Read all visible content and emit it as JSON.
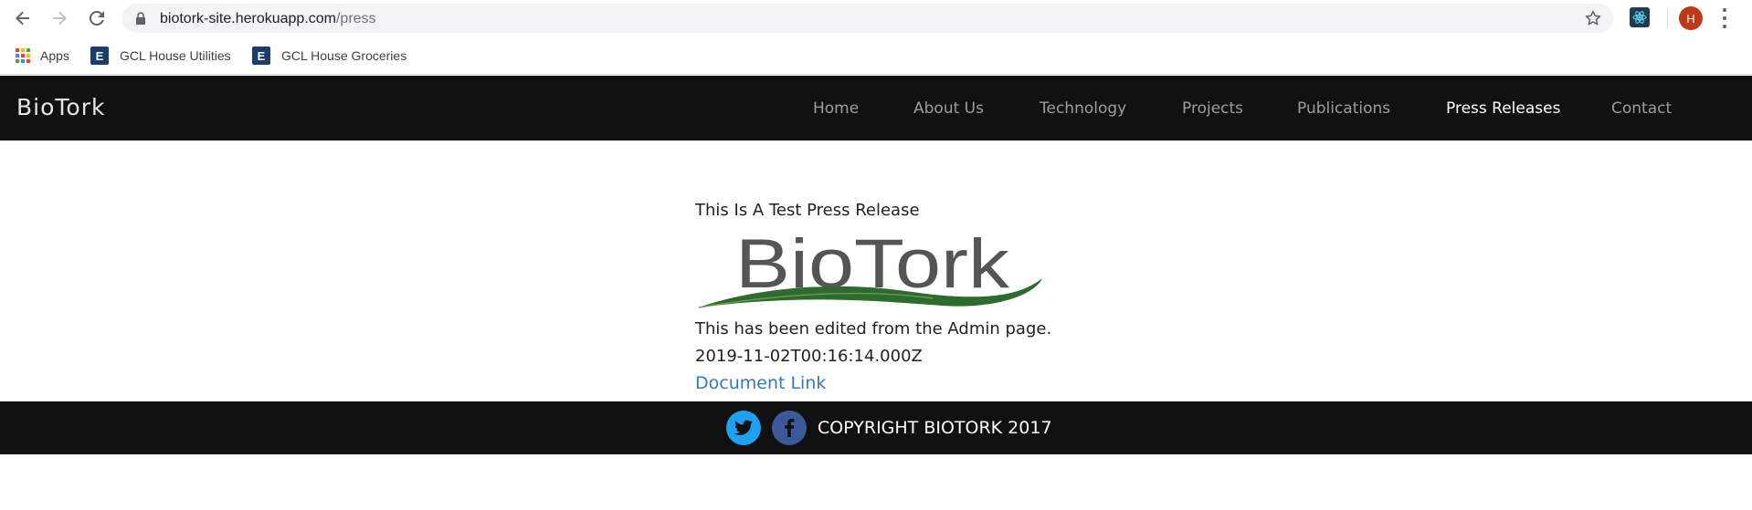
{
  "browser": {
    "url_host": "biotork-site.herokuapp.com",
    "url_path": "/press",
    "avatar_letter": "H",
    "icons": [
      "back-arrow-icon",
      "forward-arrow-icon",
      "reload-icon",
      "lock-icon",
      "star-icon",
      "react-devtools-icon",
      "menu-icon"
    ]
  },
  "bookmarks": [
    {
      "label": "Apps",
      "icon": "apps-grid-icon"
    },
    {
      "label": "GCL House Utilities",
      "icon_letter": "E"
    },
    {
      "label": "GCL House Groceries",
      "icon_letter": "E"
    }
  ],
  "site": {
    "brand": "BioTork",
    "nav": [
      "Home",
      "About Us",
      "Technology",
      "Projects",
      "Publications",
      "Press Releases",
      "Contact"
    ],
    "active_nav": "Press Releases"
  },
  "press_release": {
    "title": "This Is A Test Press Release",
    "logo_text": "BioTork",
    "body": "This has been edited from the Admin page.",
    "date": "2019-11-02T00:16:14.000Z",
    "link_label": "Document Link"
  },
  "footer": {
    "copyright": "COPYRIGHT BIOTORK 2017",
    "social": [
      "twitter-icon",
      "facebook-icon"
    ]
  },
  "colors": {
    "navbar_bg": "#111111",
    "link": "#337ab7",
    "twitter": "#1da1f2",
    "facebook": "#3b5998",
    "logo_gray": "#555555",
    "logo_green": "#2e6b2f"
  }
}
